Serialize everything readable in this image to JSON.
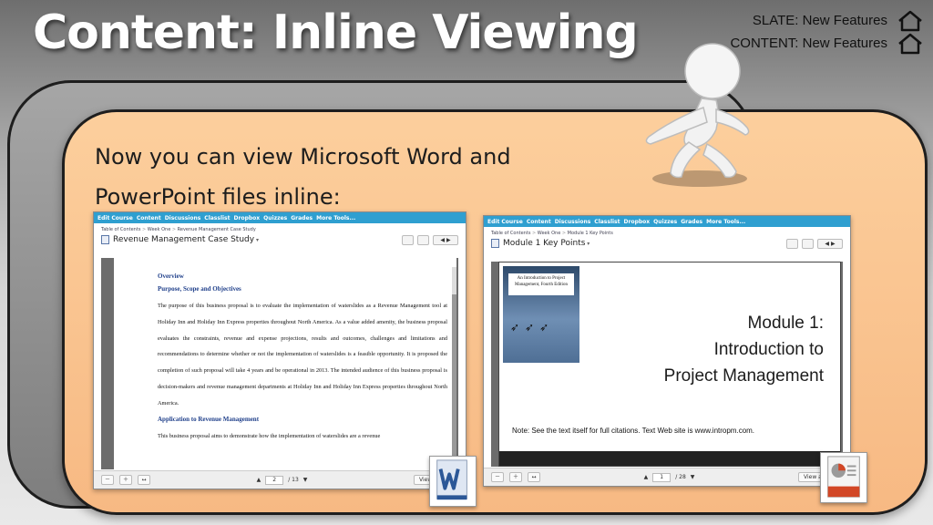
{
  "title": "Content: Inline Viewing",
  "nav": {
    "slate": "SLATE: New Features",
    "content": "CONTENT: New Features"
  },
  "lead": {
    "line1": "Now you can view Microsoft Word and",
    "line2": "PowerPoint files inline:"
  },
  "lms_toolbar": [
    "Edit Course",
    "Content",
    "Discussions",
    "Classlist",
    "Dropbox",
    "Quizzes",
    "Grades",
    "More Tools..."
  ],
  "shot1": {
    "breadcrumb": [
      "Table of Contents",
      "Week One",
      "Revenue Management Case Study"
    ],
    "doc_title": "Revenue Management Case Study",
    "doc": {
      "overview": "Overview",
      "purpose_heading": "Purpose, Scope and Objectives",
      "paragraph1": "The purpose of this business proposal is to evaluate the implementation of waterslides as a Revenue Management tool at Holiday Inn and Holiday Inn Express properties throughout North America. As a value added amenity, the business proposal evaluates the constraints, revenue and expense projections, results and outcomes, challenges and limitations and recommendations to determine whether or not the implementation of waterslides is a feasible opportunity. It is proposed the completion of such proposal will take 4 years and be operational in 2013. The intended audience of this business proposal is decision-makers and revenue management departments at Holiday Inn and Holiday Inn Express properties throughout North America.",
      "application_heading": "Application to Revenue Management",
      "paragraph2": "This business proposal aims to demonstrate how the implementation of waterslides are a revenue"
    },
    "page": "2",
    "page_total": "/ 13",
    "view_as_text": "View as Text"
  },
  "shot2": {
    "breadcrumb": [
      "Table of Contents",
      "Week One",
      "Module 1 Key Points"
    ],
    "doc_title": "Module 1 Key Points",
    "book_title": "An Introduction to Project Management, Fourth Edition",
    "slide_title": [
      "Module 1:",
      "Introduction to",
      "Project Management"
    ],
    "slide_note": "Note: See the text itself for full citations. Text Web site is www.intropm.com.",
    "page": "1",
    "page_total": "/ 28",
    "view_as_text": "View as Text"
  },
  "colors": {
    "panel": "#fccf9d",
    "toolbar": "#2f9fd0",
    "word_blue": "#2b5797",
    "ppt_orange": "#d24726"
  },
  "icons": [
    "home-icon",
    "word-file-icon",
    "powerpoint-file-icon",
    "pointing-figure"
  ]
}
